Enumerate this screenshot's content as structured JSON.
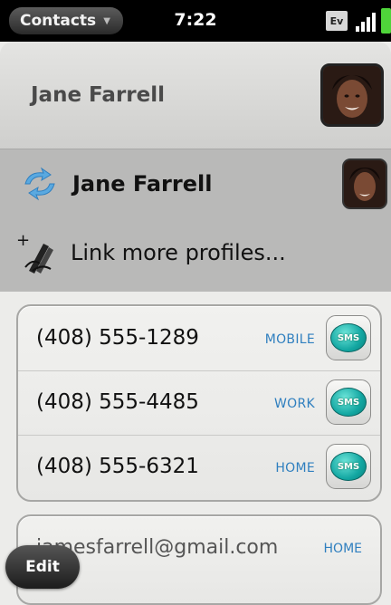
{
  "status_bar": {
    "app_menu_label": "Contacts",
    "time": "7:22",
    "network_badge": "Ev"
  },
  "header": {
    "contact_name": "Jane Farrell"
  },
  "profiles": {
    "linked_profile_name": "Jane Farrell",
    "link_more_label": "Link more profiles..."
  },
  "phones": [
    {
      "number": "(408) 555-1289",
      "label": "MOBILE",
      "sms": "SMS"
    },
    {
      "number": "(408) 555-4485",
      "label": "WORK",
      "sms": "SMS"
    },
    {
      "number": "(408) 555-6321",
      "label": "HOME",
      "sms": "SMS"
    }
  ],
  "email": {
    "address": "jamesfarrell@gmail.com",
    "label": "HOME"
  },
  "edit_label": "Edit",
  "colors": {
    "accent_label": "#2f7fbf",
    "sms_teal": "#13a7a2",
    "battery_green": "#4fd43a"
  }
}
